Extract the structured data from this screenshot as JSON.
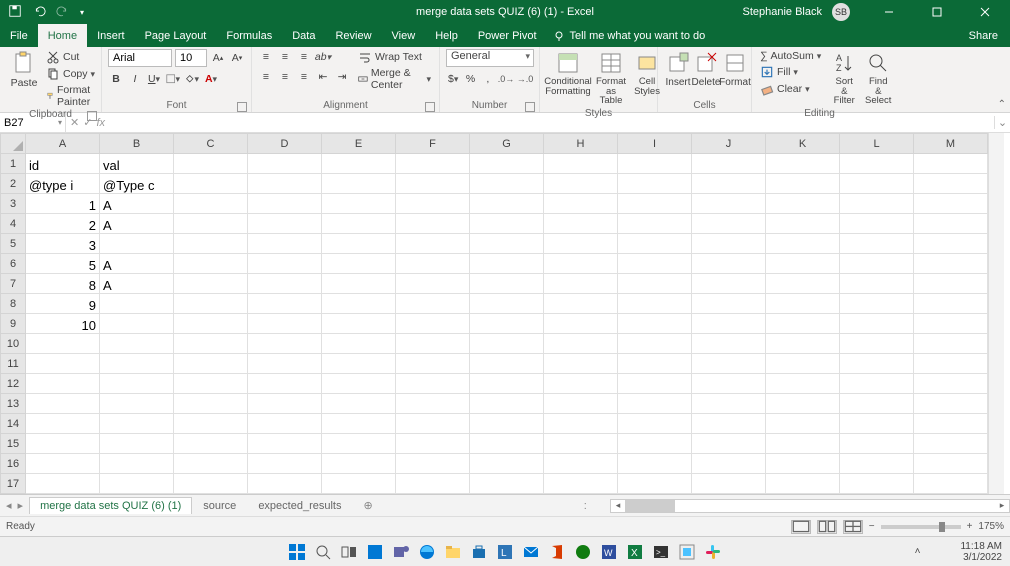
{
  "titlebar": {
    "title": "merge data sets QUIZ (6) (1) - Excel",
    "user_name": "Stephanie Black",
    "user_initials": "SB"
  },
  "menus": {
    "file": "File",
    "home": "Home",
    "insert": "Insert",
    "pagelayout": "Page Layout",
    "formulas": "Formulas",
    "data": "Data",
    "review": "Review",
    "view": "View",
    "help": "Help",
    "powerpivot": "Power Pivot",
    "tellme": "Tell me what you want to do",
    "share": "Share"
  },
  "ribbon": {
    "clipboard": {
      "paste": "Paste",
      "cut": "Cut",
      "copy": "Copy",
      "formatpainter": "Format Painter",
      "label": "Clipboard"
    },
    "font": {
      "name": "Arial",
      "size": "10",
      "label": "Font"
    },
    "alignment": {
      "wrap": "Wrap Text",
      "merge": "Merge & Center",
      "label": "Alignment"
    },
    "number": {
      "format": "General",
      "label": "Number",
      "pct": "%",
      "comma": ",",
      "currency": "$"
    },
    "styles": {
      "cf": "Conditional Formatting",
      "fat": "Format as Table",
      "cs": "Cell Styles",
      "label": "Styles"
    },
    "cells": {
      "insert": "Insert",
      "delete": "Delete",
      "format": "Format",
      "label": "Cells"
    },
    "editing": {
      "autosum": "AutoSum",
      "fill": "Fill",
      "clear": "Clear",
      "sort": "Sort & Filter",
      "find": "Find & Select",
      "label": "Editing"
    }
  },
  "namebox": {
    "ref": "B27",
    "fx": "fx"
  },
  "columns": [
    "A",
    "B",
    "C",
    "D",
    "E",
    "F",
    "G",
    "H",
    "I",
    "J",
    "K",
    "L",
    "M"
  ],
  "rows": [
    "1",
    "2",
    "3",
    "4",
    "5",
    "6",
    "7",
    "8",
    "9",
    "10",
    "11",
    "12",
    "13",
    "14",
    "15",
    "16",
    "17"
  ],
  "cells": {
    "A1": "id",
    "B1": "val",
    "A2": "@type i",
    "B2": "@Type c",
    "A3": "1",
    "B3": "A",
    "A4": "2",
    "B4": "A",
    "A5": "3",
    "A6": "5",
    "B6": "A",
    "A7": "8",
    "B7": "A",
    "A8": "9",
    "A9": "10"
  },
  "numericCells": [
    "A3",
    "A4",
    "A5",
    "A6",
    "A7",
    "A8",
    "A9"
  ],
  "sheets": {
    "t1": "merge data sets QUIZ (6) (1)",
    "t2": "source",
    "t3": "expected_results"
  },
  "status": {
    "ready": "Ready",
    "zoom": "175%"
  },
  "taskbar": {
    "time": "11:18 AM",
    "date": "3/1/2022"
  }
}
